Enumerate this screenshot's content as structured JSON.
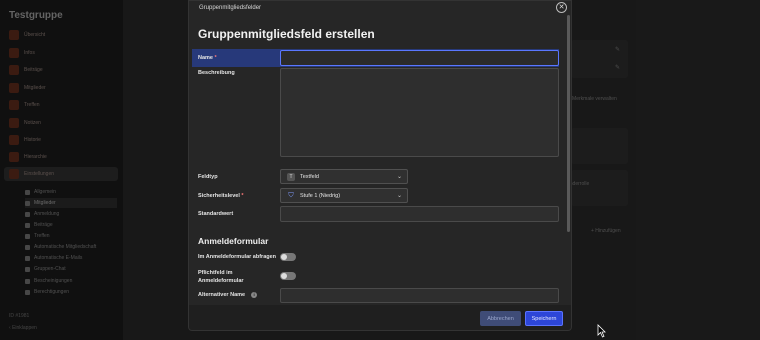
{
  "app": {
    "title": "Testgruppe",
    "nav": [
      "Übersicht",
      "Infos",
      "Beiträge",
      "Mitglieder",
      "Treffen",
      "Notizen",
      "Historie",
      "Hierarchie",
      "Einstellungen"
    ],
    "subnav": [
      "Allgemein",
      "Mitglieder",
      "Anmeldung",
      "Beiträge",
      "Treffen",
      "Automatische Mitgliedschaft",
      "Automatische E-Mails",
      "Gruppen-Chat",
      "Bescheinigungen",
      "Berechtigungen"
    ],
    "id_label": "ID #1981",
    "collapse_label": "Einklappen",
    "bg_text_1": "r Merkmale verwalten",
    "bg_text_2": "anderrolle",
    "bg_add": "+ Hinzufügen"
  },
  "modal": {
    "header": "Gruppenmitgliedsfelder",
    "title": "Gruppenmitgliedsfeld erstellen",
    "fields": {
      "name_label": "Name",
      "required_mark": "*",
      "description_label": "Beschreibung",
      "fieldtype_label": "Feldtyp",
      "fieldtype_value": "Textfeld",
      "security_label": "Sicherheitslevel",
      "security_value": "Stufe 1 (Niedrig)",
      "default_label": "Standardwert"
    },
    "registration": {
      "section_title": "Anmeldeformular",
      "ask_label": "Im Anmeldeformular abfragen",
      "required_label_1": "Pflichtfeld im",
      "required_label_2": "Anmeldeformular",
      "alt_name_label": "Alternativer Name"
    },
    "buttons": {
      "cancel": "Abbrechen",
      "save": "Speichern"
    }
  },
  "colors": {
    "accent": "#2d46d8",
    "focus_row": "#27397a",
    "nav_icon": "#5b2a1b"
  }
}
